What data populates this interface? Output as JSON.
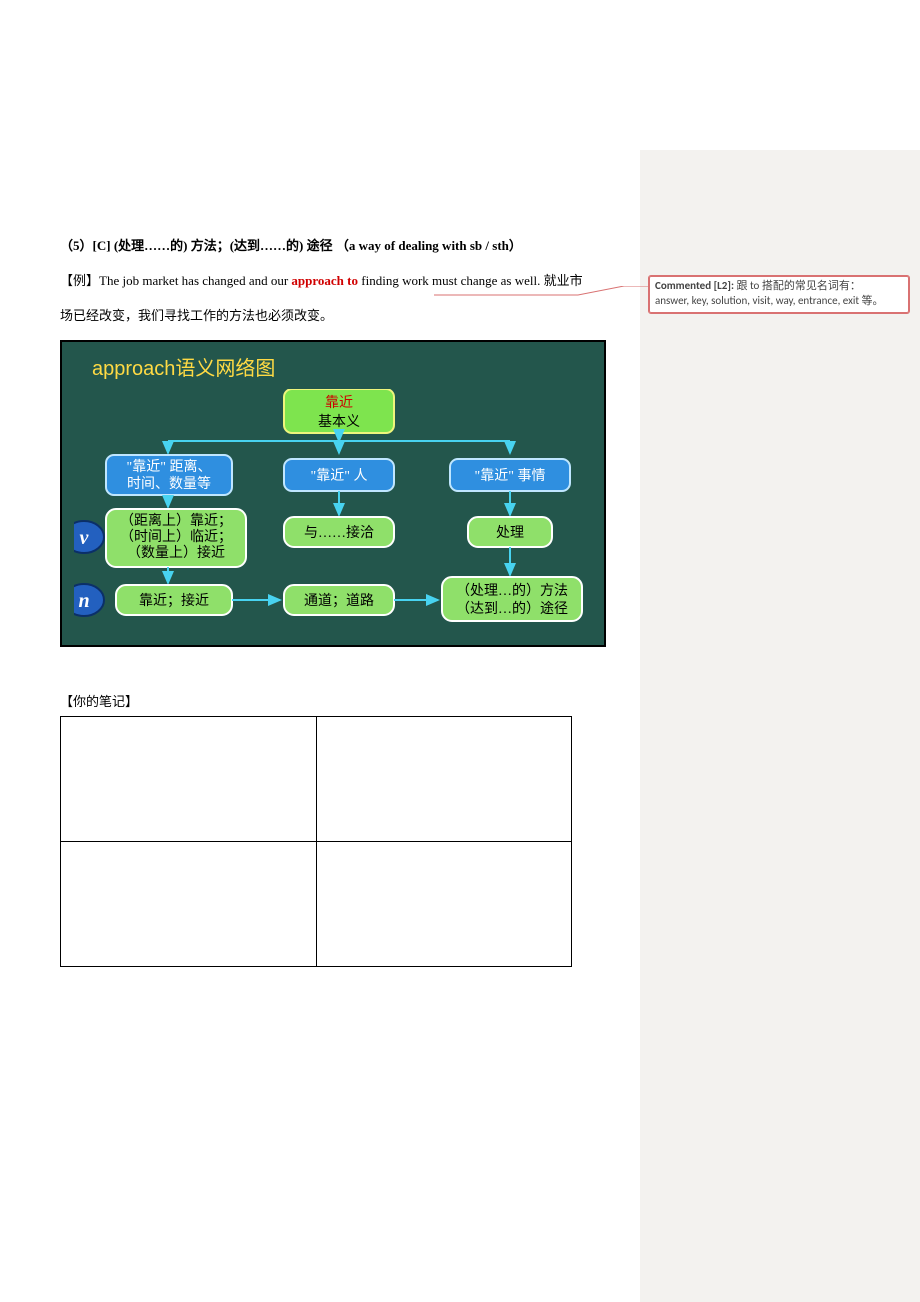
{
  "heading5": {
    "label": "（5）",
    "c_marker": "[C]",
    "cn_phrase": "(处理……的)  方法；(达到……的)  途径  （",
    "en_phrase": "a way of dealing with sb / sth",
    "tail": "）"
  },
  "example": {
    "tag_open": "【例】",
    "pre": "The job market has changed and our ",
    "approach": "approach",
    "to": " to ",
    "post": "finding work must change as well.",
    "cn_line1_tail": "  就业市",
    "cn_line2": "场已经改变，我们寻找工作的方法也必须改变。"
  },
  "comment": {
    "head": "Commented [L2]:",
    "line1": "  跟 to 搭配的常见名词有：",
    "line2": "answer, key, solution, visit, way, entrance, exit 等。"
  },
  "diagram": {
    "title": "approach语义网络图",
    "root_l1": "靠近",
    "root_l2": "基本义",
    "mid_left_l1": "\"靠近\" 距离、",
    "mid_left_l2": "时间、数量等",
    "mid_center": "\"靠近\" 人",
    "mid_right": "\"靠近\" 事情",
    "v_left_l1": "（距离上）靠近；",
    "v_left_l2": "（时间上）临近；",
    "v_left_l3": "（数量上）接近",
    "v_center": "与……接洽",
    "v_right": "处理",
    "n_left": "靠近；接近",
    "n_center": "通道；道路",
    "n_right_l1": "（处理…的）方法",
    "n_right_l2": "（达到…的）途径",
    "side_v": "v",
    "side_n": "n"
  },
  "notes_label": "【你的笔记】"
}
